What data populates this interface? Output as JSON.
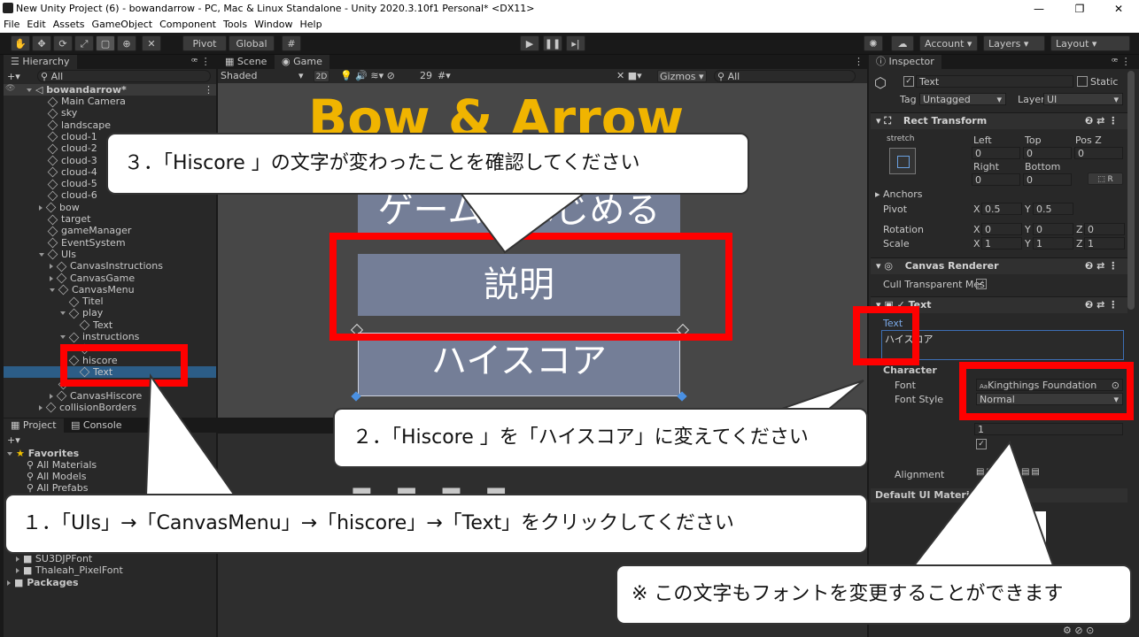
{
  "window": {
    "title": "New Unity Project (6) - bowandarrow - PC, Mac & Linux Standalone - Unity 2020.3.10f1 Personal* <DX11>",
    "min": "—",
    "max": "❐",
    "close": "✕"
  },
  "menu": [
    "File",
    "Edit",
    "Assets",
    "GameObject",
    "Component",
    "Tools",
    "Window",
    "Help"
  ],
  "toolbar": {
    "pivot": "Pivot",
    "global": "Global",
    "account": "Account",
    "layers": "Layers",
    "layout": "Layout"
  },
  "hierarchy": {
    "tab": "Hierarchy",
    "search_placeholder": "All",
    "scene": "bowandarrow*",
    "items": [
      {
        "label": "Main Camera",
        "depth": 1
      },
      {
        "label": "sky",
        "depth": 1
      },
      {
        "label": "landscape",
        "depth": 1
      },
      {
        "label": "cloud-1",
        "depth": 1
      },
      {
        "label": "cloud-2",
        "depth": 1
      },
      {
        "label": "cloud-3",
        "depth": 1
      },
      {
        "label": "cloud-4",
        "depth": 1
      },
      {
        "label": "cloud-5",
        "depth": 1
      },
      {
        "label": "cloud-6",
        "depth": 1
      },
      {
        "label": "bow",
        "depth": 1
      },
      {
        "label": "target",
        "depth": 1
      },
      {
        "label": "gameManager",
        "depth": 1
      },
      {
        "label": "EventSystem",
        "depth": 1
      },
      {
        "label": "UIs",
        "depth": 1
      },
      {
        "label": "CanvasInstructions",
        "depth": 2
      },
      {
        "label": "CanvasGame",
        "depth": 2
      },
      {
        "label": "CanvasMenu",
        "depth": 2
      },
      {
        "label": "Titel",
        "depth": 3
      },
      {
        "label": "play",
        "depth": 3
      },
      {
        "label": "Text",
        "depth": 4
      },
      {
        "label": "instructions",
        "depth": 3
      },
      {
        "label": "",
        "depth": 4
      },
      {
        "label": "hiscore",
        "depth": 3
      },
      {
        "label": "Text",
        "depth": 4
      },
      {
        "label": "",
        "depth": 2
      },
      {
        "label": "CanvasHiscore",
        "depth": 2
      },
      {
        "label": "collisionBorders",
        "depth": 1
      }
    ]
  },
  "project": {
    "tab_project": "Project",
    "tab_console": "Console",
    "favorites": "Favorites",
    "fav_items": [
      "All Materials",
      "All Models",
      "All Prefabs"
    ],
    "folders": [
      "SU3DJPFont",
      "Thaleah_PixelFont"
    ],
    "packages": "Packages"
  },
  "scene_tabs": {
    "scene": "Scene",
    "game": "Game",
    "shaded": "Shaded",
    "mode2d": "2D",
    "layers_count": "29",
    "gizmos": "Gizmos",
    "search_placeholder": "All"
  },
  "game": {
    "title": "Bow & Arrow",
    "btn_start": "ゲームをはじめる",
    "btn_explain": "説明",
    "btn_hiscore": "ハイスコア"
  },
  "inspector": {
    "tab": "Inspector",
    "object_name": "Text",
    "static": "Static",
    "tag_label": "Tag",
    "tag_value": "Untagged",
    "layer_label": "Layer",
    "layer_value": "UI",
    "rect_transform": "Rect Transform",
    "stretch": "stretch",
    "left": "Left",
    "top": "Top",
    "posz": "Pos Z",
    "left_v": "0",
    "top_v": "0",
    "posz_v": "0",
    "right": "Right",
    "bottom": "Bottom",
    "right_v": "0",
    "bottom_v": "0",
    "anchors": "Anchors",
    "pivot": "Pivot",
    "pivot_x": "0.5",
    "pivot_y": "0.5",
    "rotation": "Rotation",
    "rot_x": "0",
    "rot_y": "0",
    "rot_z": "0",
    "scale": "Scale",
    "scale_x": "1",
    "scale_y": "1",
    "scale_z": "1",
    "canvas_renderer": "Canvas Renderer",
    "cull": "Cull Transparent Mes",
    "text_component": "Text",
    "text_label": "Text",
    "text_value": "ハイスコア",
    "character": "Character",
    "font_label": "Font",
    "font_value": "Kingthings Foundation",
    "font_style_label": "Font Style",
    "font_style_value": "Normal",
    "line_spacing_value": "1",
    "alignment": "Alignment",
    "default_material": "Default UI Material"
  },
  "callouts": {
    "c1": "１．「UIs」→「CanvasMenu」→「hiscore」→「Text」をクリックしてください",
    "c2": "２．「Hiscore 」を「ハイスコア」に変えてください",
    "c3": "３．「Hiscore 」の文字が変わったことを確認してください",
    "c4": "※ この文字もフォントを変更することができます"
  },
  "colors": {
    "highlight": "#ff0000",
    "panel": "#282828",
    "button": "#747e97",
    "title_gold": "#f0b400"
  }
}
